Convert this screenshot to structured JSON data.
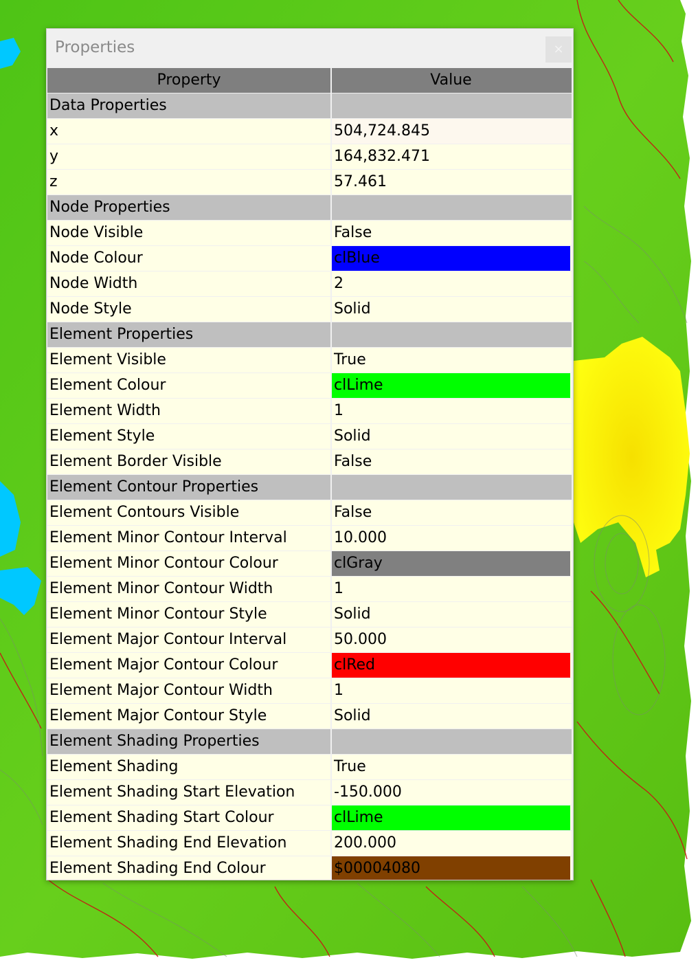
{
  "window": {
    "title": "Properties",
    "close_label": "×"
  },
  "grid": {
    "headers": {
      "property": "Property",
      "value": "Value"
    },
    "rows": [
      {
        "kind": "group",
        "name": "Data Properties",
        "value": ""
      },
      {
        "kind": "prop",
        "name": "x",
        "value": "504,724.845",
        "selected": true
      },
      {
        "kind": "prop",
        "name": "y",
        "value": "164,832.471"
      },
      {
        "kind": "prop",
        "name": "z",
        "value": "57.461"
      },
      {
        "kind": "group",
        "name": "Node Properties",
        "value": ""
      },
      {
        "kind": "prop",
        "name": "Node Visible",
        "value": "False"
      },
      {
        "kind": "prop",
        "name": "Node Colour",
        "value": "clBlue",
        "swatch": "#0000ff"
      },
      {
        "kind": "prop",
        "name": "Node Width",
        "value": "2"
      },
      {
        "kind": "prop",
        "name": "Node Style",
        "value": "Solid"
      },
      {
        "kind": "group",
        "name": "Element Properties",
        "value": ""
      },
      {
        "kind": "prop",
        "name": "Element Visible",
        "value": "True"
      },
      {
        "kind": "prop",
        "name": "Element Colour",
        "value": "clLime",
        "swatch": "#00ff00"
      },
      {
        "kind": "prop",
        "name": "Element Width",
        "value": "1"
      },
      {
        "kind": "prop",
        "name": "Element Style",
        "value": "Solid"
      },
      {
        "kind": "prop",
        "name": "Element Border Visible",
        "value": "False"
      },
      {
        "kind": "group",
        "name": "Element Contour Properties",
        "value": ""
      },
      {
        "kind": "prop",
        "name": "Element Contours Visible",
        "value": "False"
      },
      {
        "kind": "prop",
        "name": "Element Minor Contour Interval",
        "value": "10.000"
      },
      {
        "kind": "prop",
        "name": "Element Minor Contour Colour",
        "value": "clGray",
        "swatch": "#808080"
      },
      {
        "kind": "prop",
        "name": "Element Minor Contour Width",
        "value": "1"
      },
      {
        "kind": "prop",
        "name": "Element Minor Contour Style",
        "value": "Solid"
      },
      {
        "kind": "prop",
        "name": "Element Major Contour Interval",
        "value": "50.000"
      },
      {
        "kind": "prop",
        "name": "Element Major Contour Colour",
        "value": "clRed",
        "swatch": "#ff0000"
      },
      {
        "kind": "prop",
        "name": "Element Major Contour Width",
        "value": "1"
      },
      {
        "kind": "prop",
        "name": "Element Major Contour Style",
        "value": "Solid"
      },
      {
        "kind": "group",
        "name": "Element Shading Properties",
        "value": ""
      },
      {
        "kind": "prop",
        "name": "Element Shading",
        "value": "True"
      },
      {
        "kind": "prop",
        "name": "Element Shading Start Elevation",
        "value": "-150.000"
      },
      {
        "kind": "prop",
        "name": "Element Shading Start Colour",
        "value": "clLime",
        "swatch": "#00ff00"
      },
      {
        "kind": "prop",
        "name": "Element Shading End Elevation",
        "value": "200.000"
      },
      {
        "kind": "prop",
        "name": "Element Shading End Colour",
        "value": "$00004080",
        "swatch": "#804000"
      }
    ]
  },
  "colors": {
    "header_bg": "#7f7f7f",
    "group_bg": "#bfbfbf",
    "row_bg": "#ffffe6",
    "terrain_green": "#5cc81a",
    "terrain_yellow": "#ffff00",
    "water_cyan": "#00c8ff",
    "contour_red": "#c81414"
  }
}
